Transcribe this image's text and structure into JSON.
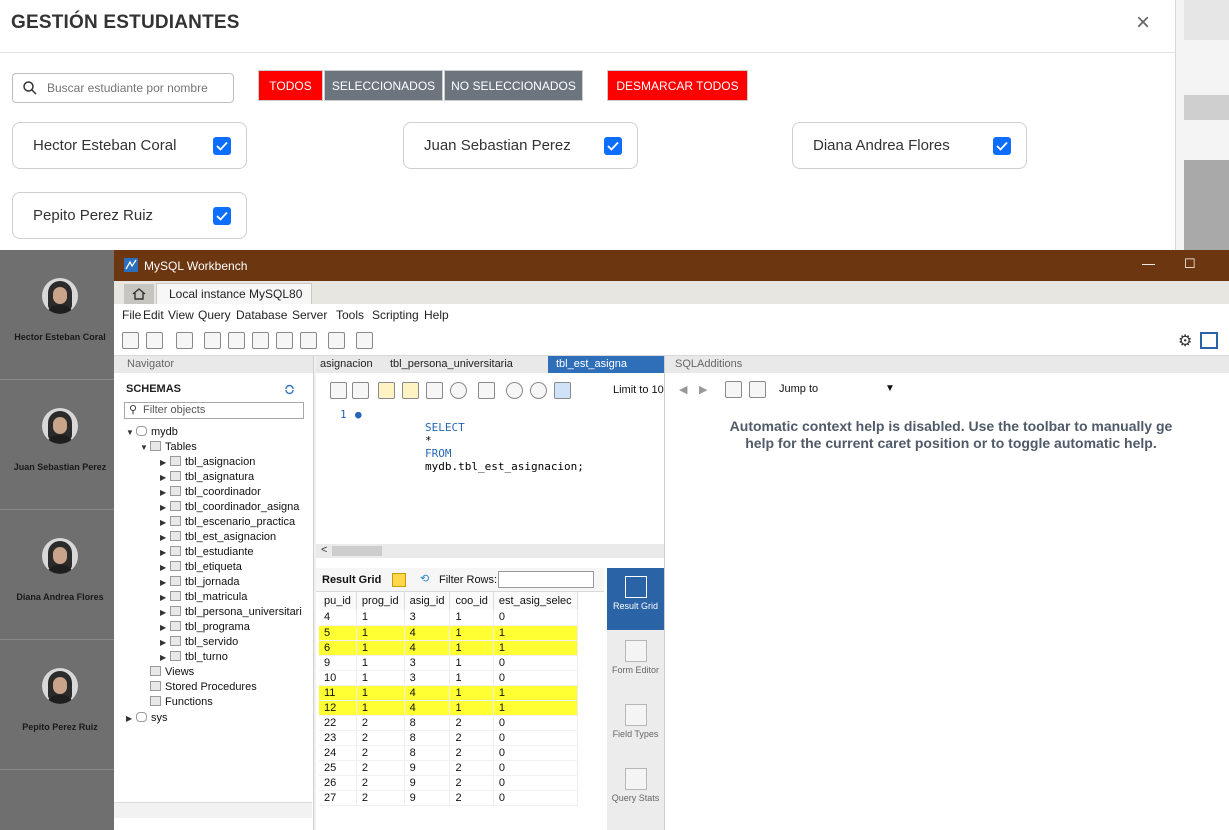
{
  "modal": {
    "title": "GESTIÓN ESTUDIANTES",
    "close": "×",
    "search_placeholder": "Buscar estudiante por nombre",
    "buttons": {
      "todos": "TODOS",
      "seleccionados": "SELECCIONADOS",
      "no_seleccionados": "NO SELECCIONADOS",
      "desmarcar": "DESMARCAR TODOS"
    },
    "students": [
      {
        "name": "Hector Esteban Coral",
        "checked": true
      },
      {
        "name": "Juan Sebastian Perez",
        "checked": true
      },
      {
        "name": "Diana Andrea Flores",
        "checked": true
      },
      {
        "name": "Pepito Perez Ruiz",
        "checked": true
      }
    ],
    "colors": {
      "red": "#ff0000",
      "gray": "#6c757d",
      "checkbox": "#0d6efd"
    }
  },
  "background_list": {
    "students": [
      "Hector Esteban Coral",
      "Juan Sebastian Perez",
      "Diana Andrea Flores",
      "Pepito Perez Ruiz"
    ]
  },
  "workbench": {
    "title": "MySQL Workbench",
    "connection_tab": "Local instance MySQL80",
    "connection_tab_close": "×",
    "menu": [
      "File",
      "Edit",
      "View",
      "Query",
      "Database",
      "Server",
      "Tools",
      "Scripting",
      "Help"
    ],
    "navigator": {
      "header": "Navigator",
      "schemas_label": "SCHEMAS",
      "filter_placeholder": "Filter objects",
      "schema": "mydb",
      "tables_label": "Tables",
      "tables": [
        "tbl_asignacion",
        "tbl_asignatura",
        "tbl_coordinador",
        "tbl_coordinador_asigna",
        "tbl_escenario_practica",
        "tbl_est_asignacion",
        "tbl_estudiante",
        "tbl_etiqueta",
        "tbl_jornada",
        "tbl_matricula",
        "tbl_persona_universitari",
        "tbl_programa",
        "tbl_servido",
        "tbl_turno"
      ],
      "other_nodes": [
        "Views",
        "Stored Procedures",
        "Functions"
      ],
      "sys_schema": "sys"
    },
    "editor": {
      "tabs": [
        "asignacion",
        "tbl_persona_universitaria"
      ],
      "active_tab": "tbl_est_asigna",
      "limit_label": "Limit to 10",
      "sql_line_number": "1",
      "sql": {
        "kw1": "SELECT",
        "star": "*",
        "kw2": "FROM",
        "rest": "mydb.tbl_est_asignacion;"
      },
      "result_grid_label": "Result Grid",
      "filter_rows_label": "Filter Rows:",
      "columns": [
        "pu_id",
        "prog_id",
        "asig_id",
        "coo_id",
        "est_asig_selec"
      ],
      "rows": [
        [
          "4",
          "1",
          "3",
          "1",
          "0"
        ],
        [
          "5",
          "1",
          "4",
          "1",
          "1"
        ],
        [
          "6",
          "1",
          "4",
          "1",
          "1"
        ],
        [
          "9",
          "1",
          "3",
          "1",
          "0"
        ],
        [
          "10",
          "1",
          "3",
          "1",
          "0"
        ],
        [
          "11",
          "1",
          "4",
          "1",
          "1"
        ],
        [
          "12",
          "1",
          "4",
          "1",
          "1"
        ],
        [
          "22",
          "2",
          "8",
          "2",
          "0"
        ],
        [
          "23",
          "2",
          "8",
          "2",
          "0"
        ],
        [
          "24",
          "2",
          "8",
          "2",
          "0"
        ],
        [
          "25",
          "2",
          "9",
          "2",
          "0"
        ],
        [
          "26",
          "2",
          "9",
          "2",
          "0"
        ],
        [
          "27",
          "2",
          "9",
          "2",
          "0"
        ]
      ],
      "highlighted_rows": [
        1,
        2,
        5,
        6
      ],
      "side_tools": [
        "Result Grid",
        "Form Editor",
        "Field Types",
        "Query Stats"
      ]
    },
    "sql_additions": {
      "header": "SQLAdditions",
      "jump_to": "Jump to",
      "help_line1": "Automatic context help is disabled. Use the toolbar to manually ge",
      "help_line2": "help for the current caret position or to toggle automatic help."
    }
  }
}
